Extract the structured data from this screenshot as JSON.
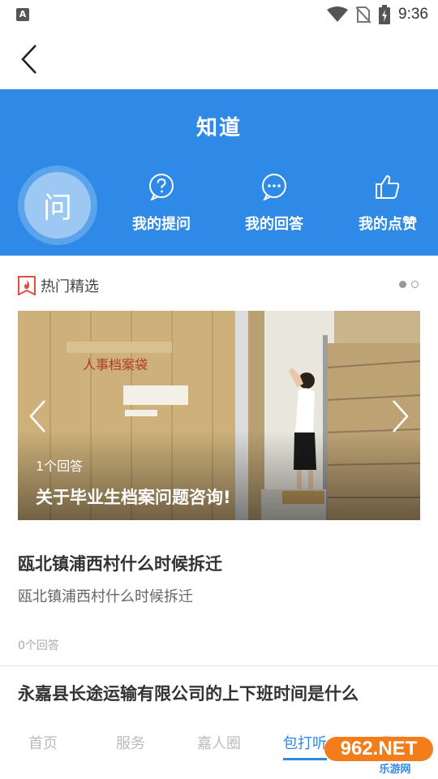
{
  "status_bar": {
    "left_icon": "A",
    "time": "9:36",
    "icons": [
      "wifi-icon",
      "no-sim-icon",
      "battery-charging-icon"
    ]
  },
  "nav": {
    "back_icon": "chevron-left-icon"
  },
  "hero": {
    "title": "知道",
    "ask_button_label": "问",
    "items": [
      {
        "label": "我的提问",
        "icon": "question-bubble-icon"
      },
      {
        "label": "我的回答",
        "icon": "chat-dots-icon"
      },
      {
        "label": "我的点赞",
        "icon": "thumbs-up-icon"
      }
    ],
    "color": "#2e8ae6"
  },
  "featured": {
    "section_title": "热门精选",
    "section_icon": "flame-badge-icon",
    "slide_index": 1,
    "slide_total": 2,
    "banner": {
      "answer_count": "1个回答",
      "title": "关于毕业生档案问题咨询!",
      "photo_sign_text": "人事档案袋"
    }
  },
  "questions": [
    {
      "title": "瓯北镇浦西村什么时候拆迁",
      "desc": "瓯北镇浦西村什么时候拆迁",
      "answer_count": "0个回答"
    },
    {
      "title": "永嘉县长途运输有限公司的上下班时间是什么"
    }
  ],
  "tabbar": {
    "tabs": [
      {
        "label": "首页"
      },
      {
        "label": "服务"
      },
      {
        "label": "嘉人圈"
      },
      {
        "label": "包打听",
        "active": true
      },
      {
        "label": "我的"
      }
    ],
    "active_color": "#2e8ae6"
  },
  "watermark": {
    "number": "962.NET",
    "text": "乐游网"
  }
}
